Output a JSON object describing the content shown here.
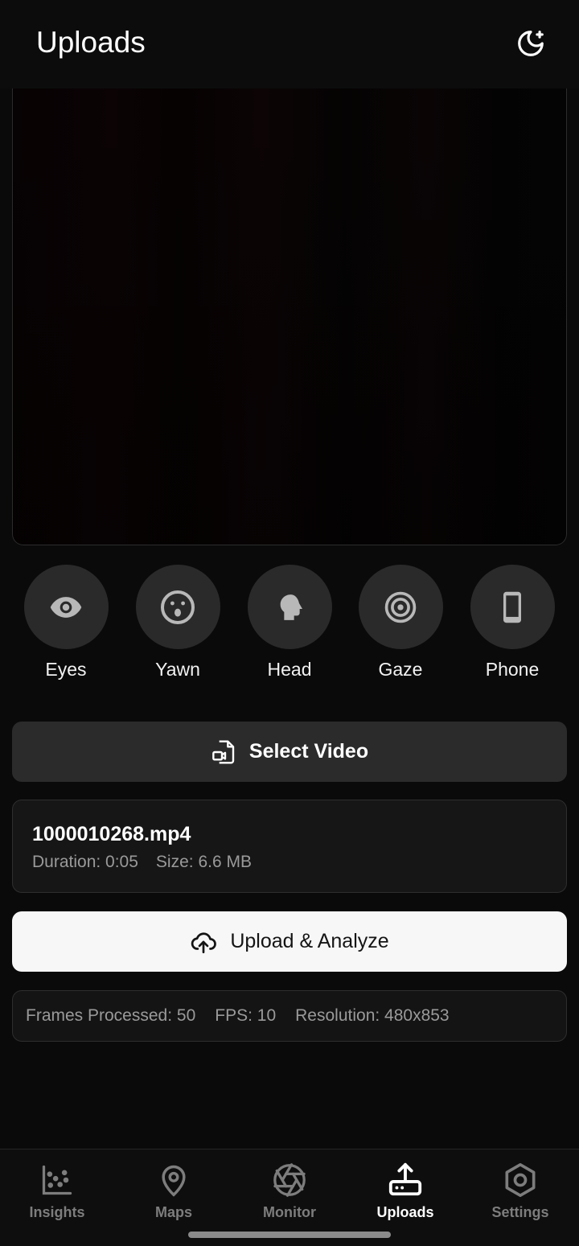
{
  "header": {
    "title": "Uploads",
    "theme_icon": "moon-sparkle-icon"
  },
  "detectors": [
    {
      "label": "Eyes",
      "icon": "eye-icon"
    },
    {
      "label": "Yawn",
      "icon": "yawn-face-icon"
    },
    {
      "label": "Head",
      "icon": "head-icon"
    },
    {
      "label": "Gaze",
      "icon": "target-icon"
    },
    {
      "label": "Phone",
      "icon": "phone-icon"
    }
  ],
  "select_button": {
    "label": "Select Video",
    "icon": "video-file-icon"
  },
  "file": {
    "name": "1000010268.mp4",
    "duration": "Duration: 0:05",
    "size": "Size: 6.6 MB"
  },
  "upload_button": {
    "label": "Upload & Analyze",
    "icon": "cloud-upload-icon"
  },
  "stats": {
    "frames": "Frames Processed: 50",
    "fps": "FPS: 10",
    "resolution": "Resolution: 480x853"
  },
  "nav": {
    "items": [
      {
        "label": "Insights",
        "icon": "scatter-chart-icon"
      },
      {
        "label": "Maps",
        "icon": "map-pin-icon"
      },
      {
        "label": "Monitor",
        "icon": "aperture-icon"
      },
      {
        "label": "Uploads",
        "icon": "upload-tray-icon"
      },
      {
        "label": "Settings",
        "icon": "hexagon-settings-icon"
      }
    ],
    "active": "Uploads"
  },
  "colors": {
    "background": "#0a0a0a",
    "surface": "#2a2a2a",
    "accent": "#ffffff",
    "muted_text": "#9a9a9a"
  }
}
